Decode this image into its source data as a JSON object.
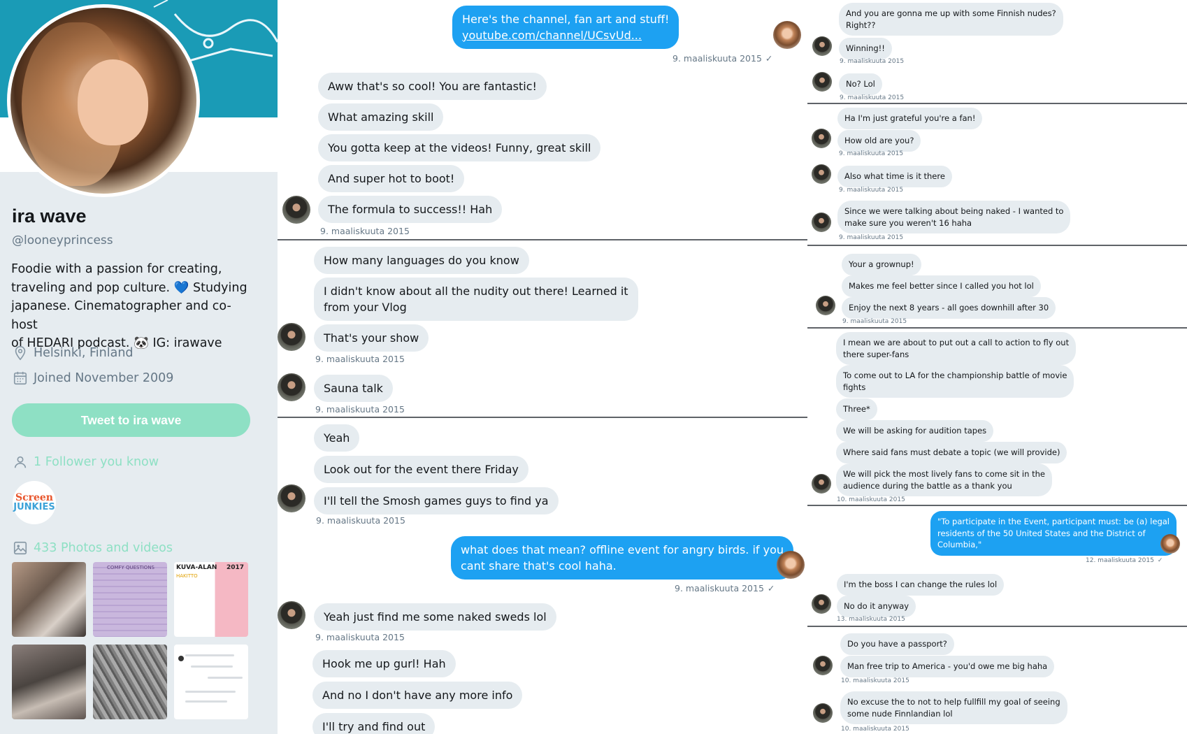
{
  "profile": {
    "name": "ira wave",
    "handle": "@looneyprincess",
    "bio_line1": "Foodie with a passion for creating,",
    "bio_line2a": "traveling and pop culture.",
    "bio_heart": "💙",
    "bio_line2b": "Studying",
    "bio_line3": "japanese. Cinematographer and co-host",
    "bio_line4a": "of HEDARI podcast.",
    "bio_panda": "🐼",
    "bio_line4b": "IG: irawave",
    "location": "Helsinki, Finland",
    "joined": "Joined November 2009",
    "tweet_button": "Tweet to ira wave",
    "followers_you_know": "1 Follower you know",
    "screenjunkies_line1": "Screen",
    "screenjunkies_line2": "JUNKIES",
    "photos_label": "433 Photos and videos",
    "thumb2_caption": "COMFY QUESTIONS",
    "thumb3_title": "KUVA-ALAN",
    "thumb3_year": "2017",
    "thumb3_sub": "HAKITTO",
    "accent_color": "#8ee0c4",
    "banner_color": "#1a9bb6"
  },
  "mid_chat": {
    "m1_line1": "Here's the channel, fan art and stuff!",
    "m1_link": "youtube.com/channel/UCsvUd...",
    "m1_time": "9. maaliskuuta 2015",
    "check": "✓",
    "m2": "Aww that's so cool! You are fantastic!",
    "m3": "What amazing skill",
    "m4": "You gotta keep at the videos! Funny, great skill",
    "m5": "And super hot to boot!",
    "m6": "The formula to success!! Hah",
    "t2": "9. maaliskuuta 2015",
    "m7": "How many languages do you know",
    "m8_line1": "I didn't know about all the nudity out there! Learned it",
    "m8_line2": "from your Vlog",
    "m9": "That's your show",
    "t3": "9. maaliskuuta 2015",
    "m10": "Sauna talk",
    "t4": "9. maaliskuuta 2015",
    "m11": "Yeah",
    "m12": "Look out for the event there Friday",
    "m13": "I'll tell the Smosh games guys to find ya",
    "t5": "9. maaliskuuta 2015",
    "m14_line1": "what does that mean? offline event for angry birds. if you",
    "m14_line2": "cant share that's cool haha.",
    "t6": "9. maaliskuuta 2015",
    "m15": "Yeah just find me some naked sweds lol",
    "t7": "9. maaliskuuta 2015",
    "m16": "Hook me up gurl! Hah",
    "m17": "And no I don't have any more info",
    "m18": "I'll try and find out"
  },
  "right_chat": {
    "r1_line1": "And you are gonna me up with some Finnish nudes?",
    "r1_line2": "Right??",
    "r2": "Winning!!",
    "rt1": "9. maaliskuuta 2015",
    "r3": "No? Lol",
    "rt2": "9. maaliskuuta 2015",
    "r4": "Ha I'm just grateful you're a fan!",
    "r5": "How old are you?",
    "rt3": "9. maaliskuuta 2015",
    "r6": "Also what time is it there",
    "rt4": "9. maaliskuuta 2015",
    "r7_line1": "Since we were talking about being naked - I wanted to",
    "r7_line2": "make sure you weren't 16 haha",
    "rt5": "9. maaliskuuta 2015",
    "r8": "Your a grownup!",
    "r9": "Makes me feel better since I called you hot lol",
    "r10": "Enjoy the next 8 years - all goes downhill after 30",
    "rt6": "9. maaliskuuta 2015",
    "r11_line1": "I mean we are about to put out a call to action to fly out",
    "r11_line2": "there super-fans",
    "r12_line1": "To come out to LA for the championship battle of movie",
    "r12_line2": "fights",
    "r13": "Three*",
    "r14": "We will be asking for audition tapes",
    "r15": "Where said fans must debate a topic (we will provide)",
    "r16_line1": "We will pick the most lively fans to come sit in the",
    "r16_line2": "audience during the battle as a thank you",
    "rt7": "10. maaliskuuta 2015",
    "r17_line1": "\"To participate in the Event, participant must: be (a) legal",
    "r17_line2": "residents of the 50 United States and the District of",
    "r17_line3": "Columbia,\"",
    "rt8": "12. maaliskuuta 2015",
    "check": "✓",
    "r18": "I'm the boss I can change the rules lol",
    "r19": "No do it anyway",
    "rt9": "13. maaliskuuta 2015",
    "r20": "Do you have a passport?",
    "r21": "Man free trip to America - you'd owe me big haha",
    "rt10": "10. maaliskuuta 2015",
    "r22_line1": "No excuse the to not to help fullfill my goal of seeing",
    "r22_line2": "some nude Finnlandian lol",
    "rt11": "10. maaliskuuta 2015"
  }
}
